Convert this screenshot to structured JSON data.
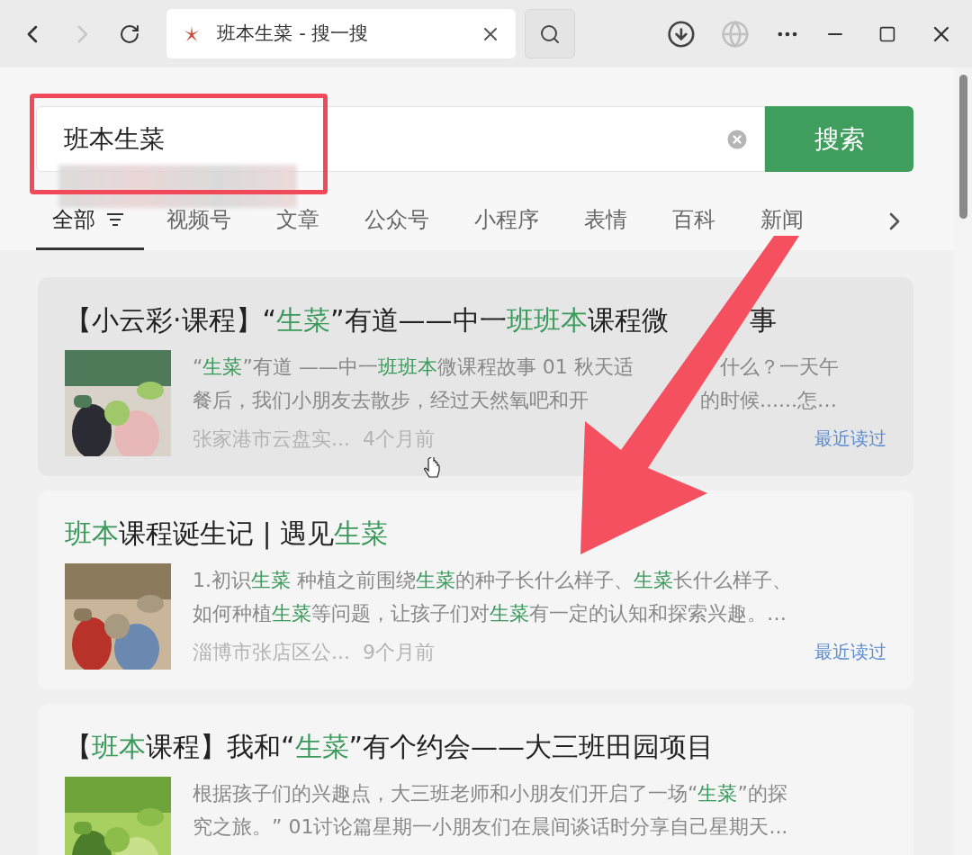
{
  "browser": {
    "tab_title": "班本生菜 - 搜一搜"
  },
  "search": {
    "value": "班本生菜",
    "button": "搜索"
  },
  "filters": [
    {
      "label": "全部",
      "selected": true
    },
    {
      "label": "视频号",
      "selected": false
    },
    {
      "label": "文章",
      "selected": false
    },
    {
      "label": "公众号",
      "selected": false
    },
    {
      "label": "小程序",
      "selected": false
    },
    {
      "label": "表情",
      "selected": false
    },
    {
      "label": "百科",
      "selected": false
    },
    {
      "label": "新闻",
      "selected": false
    }
  ],
  "results": [
    {
      "highlighted": true,
      "title": {
        "parts": [
          {
            "text": "【小云彩·课程】“",
            "match": false
          },
          {
            "text": "生菜",
            "match": true
          },
          {
            "text": "”有道——中一",
            "match": false
          },
          {
            "text": "班班本",
            "match": true
          },
          {
            "text": "课程微",
            "match": false
          }
        ],
        "after": [
          {
            "text": "事",
            "match": false
          }
        ]
      },
      "lines": [
        {
          "parts": [
            {
              "text": "“",
              "match": false
            },
            {
              "text": "生菜",
              "match": true
            },
            {
              "text": "”有道 ——中一",
              "match": false
            },
            {
              "text": "班班本",
              "match": true
            },
            {
              "text": "微课程故事 01 秋天适",
              "match": false
            }
          ],
          "after": [
            {
              "text": "什么？一天午",
              "match": false
            }
          ]
        },
        {
          "parts": [
            {
              "text": "餐后，我们小朋友去散步，经过天然氧吧和开",
              "match": false
            }
          ],
          "after": [
            {
              "text": "的时候......怎…",
              "match": false
            }
          ]
        }
      ],
      "source": "张家港市云盘实...",
      "time": "4个月前",
      "badge": "最近读过"
    },
    {
      "highlighted": false,
      "title": {
        "parts": [
          {
            "text": "班本",
            "match": true
          },
          {
            "text": "课程诞生记 | 遇见",
            "match": false
          },
          {
            "text": "生菜",
            "match": true
          }
        ]
      },
      "lines": [
        {
          "parts": [
            {
              "text": "1.初识",
              "match": false
            },
            {
              "text": "生菜",
              "match": true
            },
            {
              "text": " 种植之前围绕",
              "match": false
            },
            {
              "text": "生菜",
              "match": true
            },
            {
              "text": "的种子长什么样子、",
              "match": false
            },
            {
              "text": "生菜",
              "match": true
            },
            {
              "text": "长什么样子、",
              "match": false
            }
          ]
        },
        {
          "parts": [
            {
              "text": "如何种植",
              "match": false
            },
            {
              "text": "生菜",
              "match": true
            },
            {
              "text": "等问题，让孩子们对",
              "match": false
            },
            {
              "text": "生菜",
              "match": true
            },
            {
              "text": "有一定的认知和探索兴趣。…",
              "match": false
            }
          ]
        }
      ],
      "source": "淄博市张店区公...",
      "time": "9个月前",
      "badge": "最近读过"
    },
    {
      "highlighted": false,
      "title": {
        "parts": [
          {
            "text": "【",
            "match": false
          },
          {
            "text": "班本",
            "match": true
          },
          {
            "text": "课程】我和“",
            "match": false
          },
          {
            "text": "生菜",
            "match": true
          },
          {
            "text": "”有个约会——大三班田园项目",
            "match": false
          }
        ]
      },
      "lines": [
        {
          "parts": [
            {
              "text": "根据孩子们的兴趣点，大三班老师和小朋友们开启了一场“",
              "match": false
            },
            {
              "text": "生菜",
              "match": true
            },
            {
              "text": "”的探",
              "match": false
            }
          ]
        },
        {
          "parts": [
            {
              "text": "究之旅。” 01讨论篇星期一小朋友们在晨间谈话时分享自己星期天...",
              "match": false
            }
          ]
        }
      ]
    }
  ]
}
